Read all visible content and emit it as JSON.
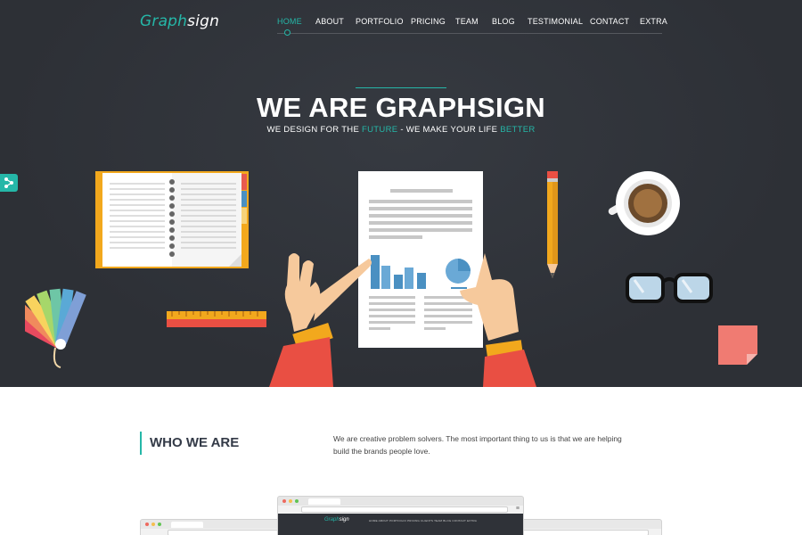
{
  "brand": {
    "accent": "Graph",
    "rest": "sign"
  },
  "nav": {
    "items": [
      {
        "label": "HOME",
        "active": true
      },
      {
        "label": "ABOUT"
      },
      {
        "label": "PORTFOLIO"
      },
      {
        "label": "PRICING"
      },
      {
        "label": "TEAM"
      },
      {
        "label": "BLOG"
      },
      {
        "label": "TESTIMONIAL"
      },
      {
        "label": "CONTACT"
      },
      {
        "label": "EXTRA"
      }
    ]
  },
  "hero": {
    "title": "WE ARE GRAPHSIGN",
    "subtitle_1": "WE DESIGN FOR THE ",
    "subtitle_hl1": "FUTURE",
    "subtitle_2": " - WE MAKE YOUR LIFE ",
    "subtitle_hl2": "BETTER"
  },
  "who": {
    "title": "WHO WE ARE",
    "text": "We are creative problem solvers. The most important thing to us is that we are helping build the brands people love."
  },
  "preview": {
    "brand_accent": "Graph",
    "brand_rest": "sign",
    "nav_text": "HOME   ABOUT   PORTFOLIO   PRICING   CLIENTS   TEAM   BLOG   CONTACT   EXTRA"
  },
  "colors": {
    "accent": "#25b7a8",
    "hero_bg": "#2f3238",
    "heading": "#333a47"
  },
  "icons": {
    "side_button": "share-icon"
  }
}
